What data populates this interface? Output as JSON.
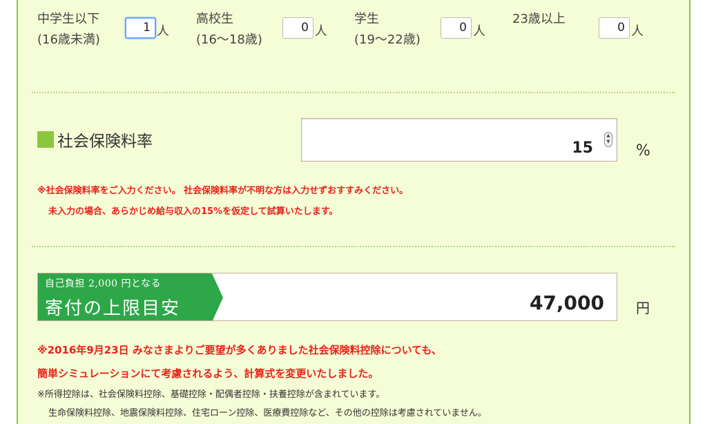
{
  "ages": [
    {
      "label_line1": "中学生以下",
      "label_line2": "(16歳未満)",
      "value": "1",
      "unit": "人",
      "focused": true
    },
    {
      "label_line1": "高校生",
      "label_line2": "(16〜18歳)",
      "value": "0",
      "unit": "人",
      "focused": false
    },
    {
      "label_line1": "学生",
      "label_line2": "(19〜22歳)",
      "value": "0",
      "unit": "人",
      "focused": false
    },
    {
      "label_line1": "23歳以上",
      "label_line2": "",
      "value": "0",
      "unit": "人",
      "focused": false
    }
  ],
  "social_insurance": {
    "title": "社会保険料率",
    "value": "15",
    "unit": "%",
    "note_line1": "※社会保険料率をご入力ください。 社会保険料率が不明な方は入力せずおすすみください。",
    "note_line2": "未入力の場合、あらかじめ給与収入の15%を仮定して試算いたします。"
  },
  "result": {
    "banner_sub": "自己負担 2,000 円となる",
    "banner_main": "寄付の上限目安",
    "value": "47,000",
    "unit": "円"
  },
  "notes": {
    "update_line1": "※2016年9月23日 みなさまよりご要望が多くありました社会保険料控除についても、",
    "update_line2": "簡単シミュレーションにて考慮されるよう、計算式を変更いたしました。",
    "deduction_line1": "※所得控除は、社会保険料控除、基礎控除・配偶者控除・扶養控除が含まれています。",
    "deduction_line2": "生命保険料控除、地震保険料控除、住宅ローン控除、医療費控除など、その他の控除は考慮されていません。"
  },
  "colors": {
    "panel_bg": "#f5fdd6",
    "accent_green": "#8cc63f",
    "banner_green": "#2ea748",
    "note_red": "#e8221b"
  }
}
